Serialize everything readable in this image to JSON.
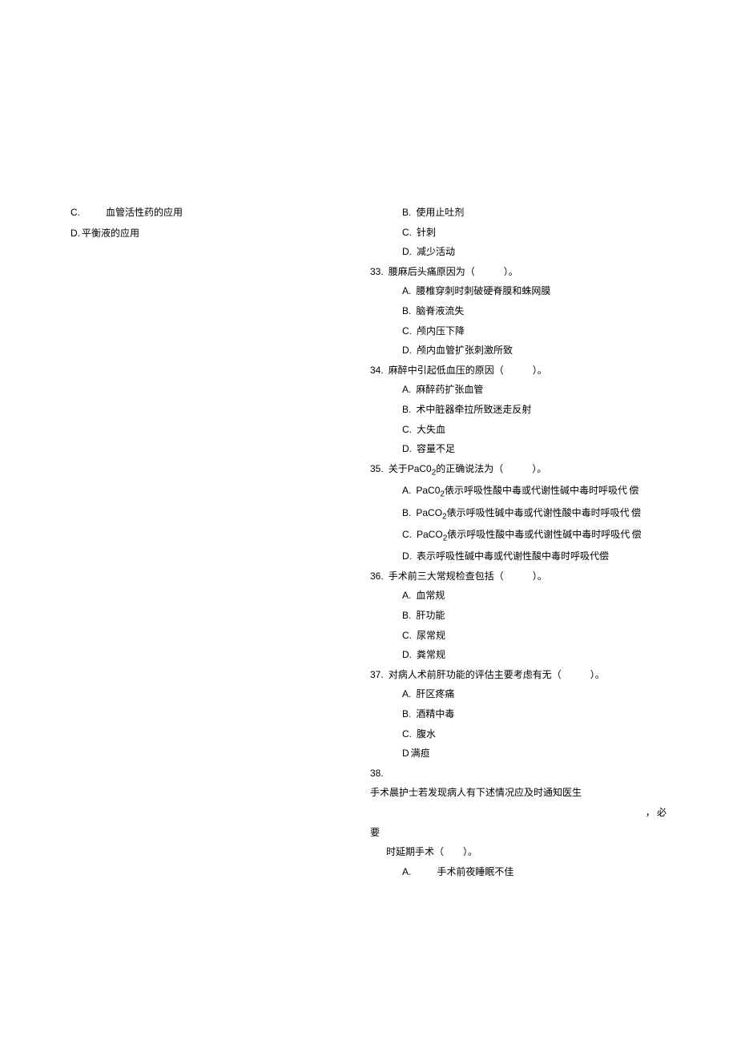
{
  "left": {
    "optC": {
      "label": "C.",
      "text": "血管活性药的应用"
    },
    "optD": {
      "label": "D.",
      "text": "平衡液的应用"
    }
  },
  "right": {
    "pre_opts": [
      {
        "label": "B.",
        "text": "使用止吐剂"
      },
      {
        "label": "C.",
        "text": "针刺"
      },
      {
        "label": "D.",
        "text": "减少活动"
      }
    ],
    "q33": {
      "num": "33.",
      "stem": "腰麻后头痛原因为（　　　）。",
      "opts": [
        {
          "label": "A.",
          "text": "腰椎穿刺时刺破硬脊膜和蛛网膜"
        },
        {
          "label": "B.",
          "text": "脑脊液流失"
        },
        {
          "label": "C.",
          "text": "颅内压下降"
        },
        {
          "label": "D.",
          "text": "颅内血管扩张刺激所致"
        }
      ]
    },
    "q34": {
      "num": "34.",
      "stem": "麻醉中引起低血压的原因（　　　）。",
      "opts": [
        {
          "label": "A.",
          "text": "麻醉药扩张血管"
        },
        {
          "label": "B.",
          "text": "术中脏器牵拉所致迷走反射"
        },
        {
          "label": "C.",
          "text": "大失血"
        },
        {
          "label": "D.",
          "text": "容量不足"
        }
      ]
    },
    "q35": {
      "num": "35.",
      "stem_pre": "关于",
      "stem_paco2": "PaC0",
      "stem_sub": "2",
      "stem_post": "的正确说法为（　　　）。",
      "opts": [
        {
          "label": "A.",
          "pre": "PaC0",
          "sub": "2",
          "post": "俵示呼吸性酸中毒或代谢性碱中毒时呼吸代 偿"
        },
        {
          "label": "B.",
          "pre": "PaCO",
          "sub": "2",
          "post": "俵示呼吸性碱中毒或代谢性酸中毒时呼吸代 偿"
        },
        {
          "label": "C.",
          "pre": "PaCO",
          "sub": "2",
          "post": "俵示呼吸性酸中毒或代谢性碱中毒时呼吸代 偿"
        },
        {
          "label": "D.",
          "text": "表示呼吸性碱中毒或代谢性酸中毒时呼吸代偿"
        }
      ]
    },
    "q36": {
      "num": "36.",
      "stem": "手术前三大常规检查包括（　　　）。",
      "opts": [
        {
          "label": "A.",
          "text": "血常规"
        },
        {
          "label": "B.",
          "text": "肝功能"
        },
        {
          "label": "C.",
          "text": "尿常规"
        },
        {
          "label": "D.",
          "text": "粪常规"
        }
      ]
    },
    "q37": {
      "num": "37.",
      "stem": "对病人术前肝功能的评估主要考虑有无（　　　）。",
      "opts": [
        {
          "label": "A.",
          "text": "肝区疼痛"
        },
        {
          "label": "B.",
          "text": "酒精中毒"
        },
        {
          "label": "C.",
          "text": "腹水"
        }
      ],
      "optD": {
        "label": "D",
        "text": "满疸"
      }
    },
    "q38": {
      "num": "38.",
      "text1": "手术晨护士若发现病人有下述情况应及时通知医生",
      "bi": "， 必",
      "yao": "要",
      "cont": "时延期手术（　　）。",
      "optA": {
        "label": "A.",
        "text": "手术前夜睡眠不佳"
      }
    }
  }
}
